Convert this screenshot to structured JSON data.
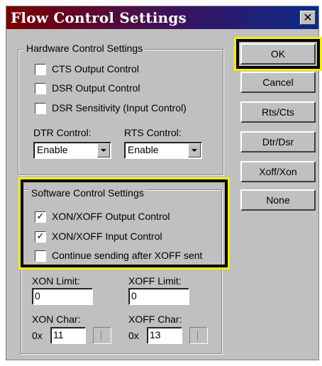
{
  "window": {
    "title": "Flow Control Settings",
    "close_glyph": "✕"
  },
  "hardware": {
    "legend": "Hardware Control Settings",
    "checkboxes": [
      {
        "label": "CTS Output Control",
        "checked": false
      },
      {
        "label": "DSR Output Control",
        "checked": false
      },
      {
        "label": "DSR Sensitivity (Input Control)",
        "checked": false
      }
    ],
    "dtr": {
      "label": "DTR Control:",
      "value": "Enable"
    },
    "rts": {
      "label": "RTS Control:",
      "value": "Enable"
    }
  },
  "software": {
    "legend": "Software Control Settings",
    "checkboxes": [
      {
        "label": "XON/XOFF Output Control",
        "checked": true
      },
      {
        "label": "XON/XOFF Input Control",
        "checked": true
      },
      {
        "label": "Continue sending after XOFF sent",
        "checked": false
      }
    ],
    "xon_limit": {
      "label": "XON Limit:",
      "value": "0"
    },
    "xoff_limit": {
      "label": "XOFF Limit:",
      "value": "0"
    },
    "xon_char": {
      "label": "XON Char:",
      "prefix": "0x",
      "value": "11"
    },
    "xoff_char": {
      "label": "XOFF Char:",
      "prefix": "0x",
      "value": "13"
    }
  },
  "buttons": {
    "ok": "OK",
    "cancel": "Cancel",
    "rts_cts": "Rts/Cts",
    "dtr_dsr": "Dtr/Dsr",
    "xoff_xon": "Xoff/Xon",
    "none": "None"
  },
  "colors": {
    "highlight": "#f6f000",
    "title_start": "#7a0000",
    "title_end": "#0a2a8a"
  }
}
